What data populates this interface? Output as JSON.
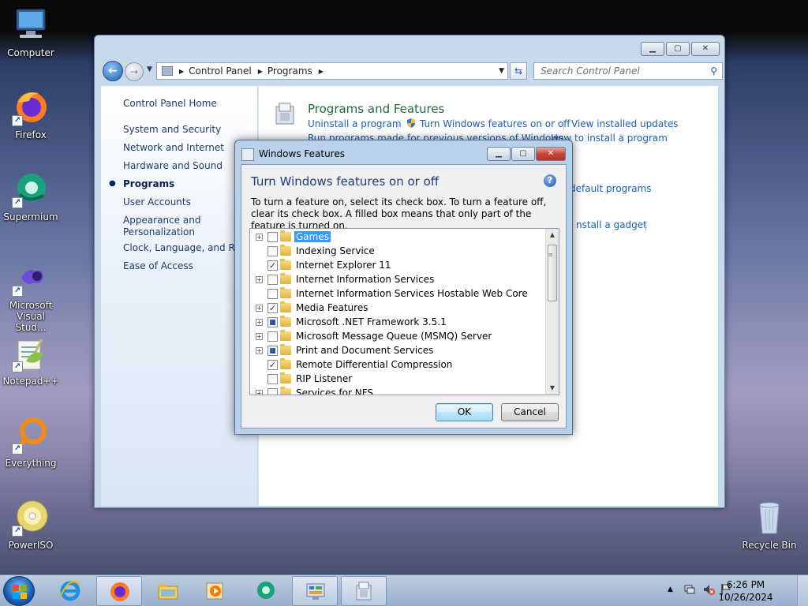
{
  "desktop": {
    "icons": [
      {
        "label": "Computer",
        "icon": "computer-icon"
      },
      {
        "label": "Firefox",
        "icon": "firefox-icon"
      },
      {
        "label": "Supermium",
        "icon": "supermium-icon"
      },
      {
        "label": "Microsoft Visual Stud...",
        "icon": "visual-studio-icon"
      },
      {
        "label": "Notepad++",
        "icon": "notepadpp-icon"
      },
      {
        "label": "Everything",
        "icon": "everything-icon"
      },
      {
        "label": "PowerISO",
        "icon": "poweriso-icon"
      },
      {
        "label": "Recycle Bin",
        "icon": "recycle-bin-icon"
      }
    ]
  },
  "explorer": {
    "breadcrumb": [
      "Control Panel",
      "Programs"
    ],
    "search_placeholder": "Search Control Panel",
    "sidebar": {
      "home": "Control Panel Home",
      "items": [
        "System and Security",
        "Network and Internet",
        "Hardware and Sound",
        "Programs",
        "User Accounts",
        "Appearance and Personalization",
        "Clock, Language, and Regi",
        "Ease of Access"
      ],
      "current": "Programs"
    },
    "main": {
      "section_title": "Programs and Features",
      "tasks": [
        "Uninstall a program",
        "Turn Windows features on or off",
        "View installed updates",
        "Run programs made for previous versions of Windows",
        "How to install a program"
      ],
      "partial_link_1": "default programs",
      "partial_link_2": "nstall a gadget"
    }
  },
  "dialog": {
    "title": "Windows Features",
    "heading": "Turn Windows features on or off",
    "description": "To turn a feature on, select its check box. To turn a feature off, clear its check box. A filled box means that only part of the feature is turned on.",
    "features": [
      {
        "name": "Games",
        "expandable": true,
        "state": "off",
        "selected": true
      },
      {
        "name": "Indexing Service",
        "expandable": false,
        "state": "off",
        "selected": false
      },
      {
        "name": "Internet Explorer 11",
        "expandable": false,
        "state": "on",
        "selected": false
      },
      {
        "name": "Internet Information Services",
        "expandable": true,
        "state": "off",
        "selected": false
      },
      {
        "name": "Internet Information Services Hostable Web Core",
        "expandable": false,
        "state": "off",
        "selected": false
      },
      {
        "name": "Media Features",
        "expandable": true,
        "state": "on",
        "selected": false
      },
      {
        "name": "Microsoft .NET Framework 3.5.1",
        "expandable": true,
        "state": "partial",
        "selected": false
      },
      {
        "name": "Microsoft Message Queue (MSMQ) Server",
        "expandable": true,
        "state": "off",
        "selected": false
      },
      {
        "name": "Print and Document Services",
        "expandable": true,
        "state": "partial",
        "selected": false
      },
      {
        "name": "Remote Differential Compression",
        "expandable": false,
        "state": "on",
        "selected": false
      },
      {
        "name": "RIP Listener",
        "expandable": false,
        "state": "off",
        "selected": false
      },
      {
        "name": "Services for NFS",
        "expandable": true,
        "state": "off",
        "selected": false
      }
    ],
    "ok_label": "OK",
    "cancel_label": "Cancel"
  },
  "taskbar": {
    "clock_time": "6:26 PM",
    "clock_date": "10/26/2024",
    "pinned": [
      "internet-explorer-icon",
      "firefox-icon",
      "file-explorer-icon",
      "media-player-icon",
      "supermium-icon",
      "control-panel-icon",
      "windows-features-icon"
    ]
  }
}
